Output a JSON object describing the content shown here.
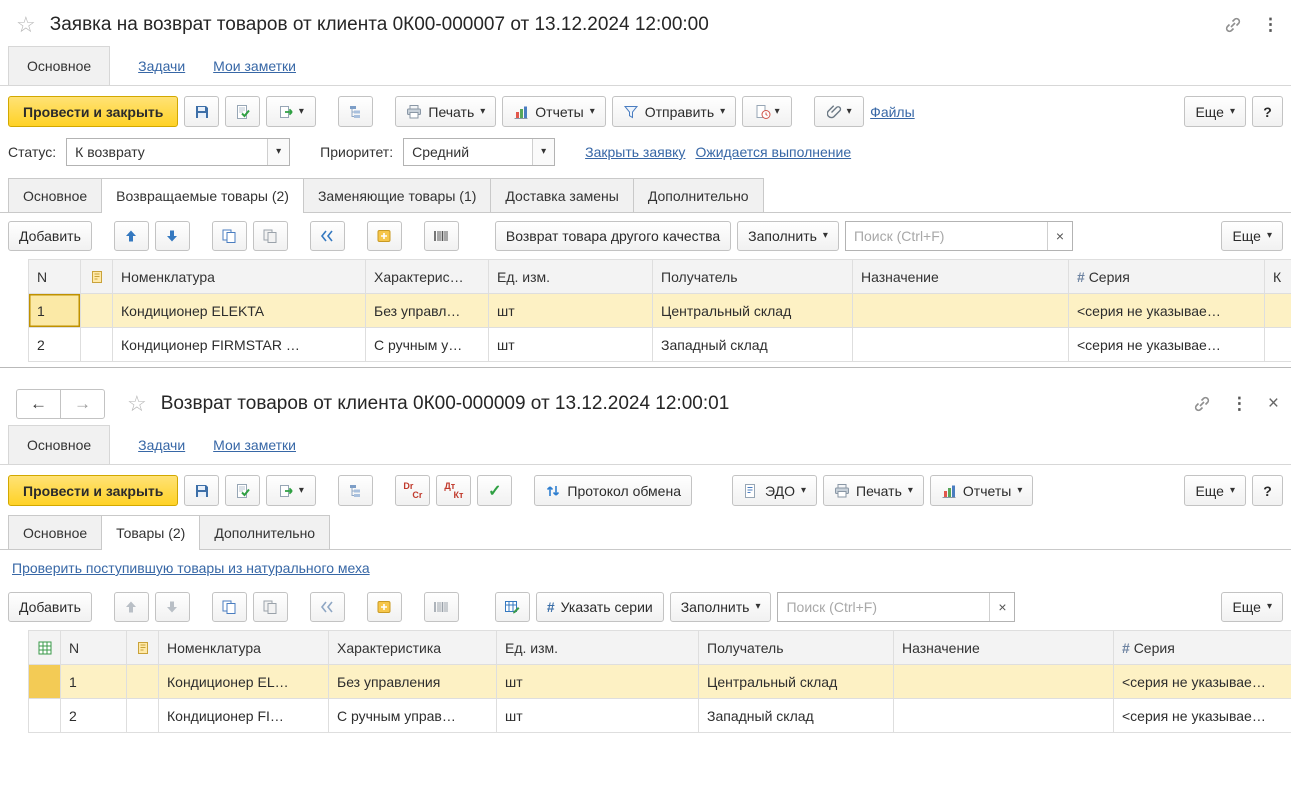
{
  "colors": {
    "accent_yellow": "#ffd226",
    "link_blue": "#3767a6",
    "selected_row": "#fdf1c4"
  },
  "icons": {
    "star": "☆",
    "kebab": "⋮",
    "close": "×",
    "back": "←",
    "forward": "→",
    "caret": "▾",
    "help": "?",
    "hash": "#",
    "check": "✓",
    "clear": "×"
  },
  "win1": {
    "title": "Заявка на возврат товаров от клиента 0К00-000007 от 13.12.2024 12:00:00",
    "nav": {
      "main": "Основное",
      "tasks": "Задачи",
      "notes": "Мои заметки"
    },
    "toolbar": {
      "post_close": "Провести и закрыть",
      "print": "Печать",
      "reports": "Отчеты",
      "send": "Отправить",
      "files": "Файлы",
      "more": "Еще"
    },
    "statusbar": {
      "status_label": "Статус:",
      "status_value": "К возврату",
      "priority_label": "Приоритет:",
      "priority_value": "Средний",
      "close_link": "Закрыть заявку",
      "pending_link": "Ожидается выполнение"
    },
    "tabs": {
      "main": "Основное",
      "returned": "Возвращаемые товары (2)",
      "replacing": "Заменяющие товары (1)",
      "delivery": "Доставка замены",
      "extra": "Дополнительно"
    },
    "grid_toolbar": {
      "add": "Добавить",
      "return_quality": "Возврат товара другого качества",
      "fill": "Заполнить",
      "search_placeholder": "Поиск (Ctrl+F)",
      "more": "Еще"
    },
    "grid": {
      "headers": {
        "num": "N",
        "nomenclature": "Номенклатура",
        "characteristic": "Характерис…",
        "unit": "Ед. изм.",
        "receiver": "Получатель",
        "purpose": "Назначение",
        "series": "Серия",
        "cut": "К"
      },
      "rows": [
        {
          "num": "1",
          "nomenclature": "Кондиционер ELEKTA",
          "characteristic": "Без управл…",
          "unit": "шт",
          "receiver": "Центральный склад",
          "purpose": "",
          "series": "<серия не указывае…"
        },
        {
          "num": "2",
          "nomenclature": "Кондиционер FIRMSTAR …",
          "characteristic": "С ручным у…",
          "unit": "шт",
          "receiver": "Западный склад",
          "purpose": "",
          "series": "<серия не указывае…"
        }
      ]
    }
  },
  "win2": {
    "title": "Возврат товаров от клиента 0К00-000009 от 13.12.2024 12:00:01",
    "nav": {
      "main": "Основное",
      "tasks": "Задачи",
      "notes": "Мои заметки"
    },
    "toolbar": {
      "post_close": "Провести и закрыть",
      "dr": "Dr",
      "cr": "Cr",
      "dt": "Дт",
      "kt": "Кт",
      "exchange_protocol": "Протокол обмена",
      "edo": "ЭДО",
      "print": "Печать",
      "reports": "Отчеты",
      "more": "Еще"
    },
    "tabs": {
      "main": "Основное",
      "goods": "Товары (2)",
      "extra": "Дополнительно"
    },
    "fur_check_link": "Проверить поступившую товары из натурального меха",
    "grid_toolbar": {
      "add": "Добавить",
      "set_series": "Указать серии",
      "fill": "Заполнить",
      "search_placeholder": "Поиск (Ctrl+F)",
      "more": "Еще"
    },
    "grid": {
      "headers": {
        "num": "N",
        "nomenclature": "Номенклатура",
        "characteristic": "Характеристика",
        "unit": "Ед. изм.",
        "receiver": "Получатель",
        "purpose": "Назначение",
        "series": "Серия"
      },
      "rows": [
        {
          "num": "1",
          "nomenclature": "Кондиционер EL…",
          "characteristic": "Без управления",
          "unit": "шт",
          "receiver": "Центральный склад",
          "purpose": "",
          "series": "<серия не указывае…"
        },
        {
          "num": "2",
          "nomenclature": "Кондиционер FI…",
          "characteristic": "С ручным управ…",
          "unit": "шт",
          "receiver": "Западный склад",
          "purpose": "",
          "series": "<серия не указывае…"
        }
      ]
    }
  }
}
